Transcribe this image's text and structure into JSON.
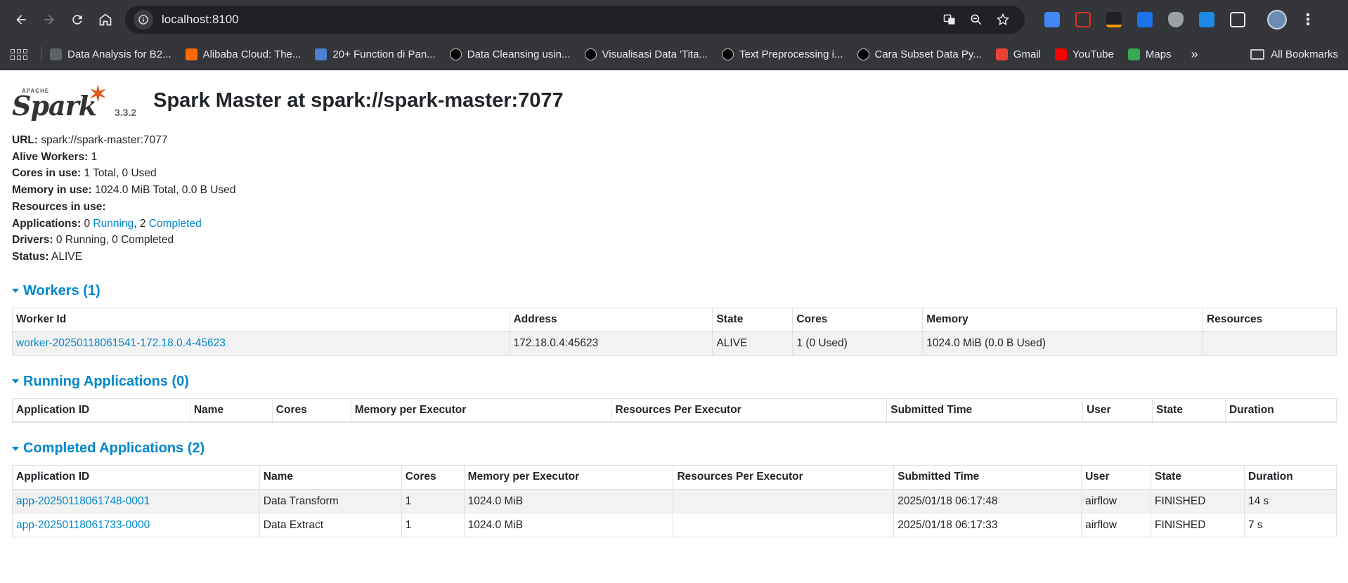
{
  "browser": {
    "url": "localhost:8100",
    "bookmarks": [
      {
        "label": "Data Analysis for B2...",
        "color": "#5f6368"
      },
      {
        "label": "Alibaba Cloud: The...",
        "color": "#ff6a00"
      },
      {
        "label": "20+ Function di Pan...",
        "color": "#4a7fd6"
      },
      {
        "label": "Data Cleansing usin...",
        "color": "#000000"
      },
      {
        "label": "Visualisasi Data 'Tita...",
        "color": "#000000"
      },
      {
        "label": "Text Preprocessing i...",
        "color": "#000000"
      },
      {
        "label": "Cara Subset Data Py...",
        "color": "#000000"
      },
      {
        "label": "Gmail",
        "color": "#ea4335"
      },
      {
        "label": "YouTube",
        "color": "#ff0000"
      },
      {
        "label": "Maps",
        "color": "#34a853"
      }
    ],
    "all_bookmarks": "All Bookmarks"
  },
  "spark": {
    "version": "3.3.2",
    "title": "Spark Master at spark://spark-master:7077",
    "summary": {
      "url_label": "URL:",
      "url": "spark://spark-master:7077",
      "alive_workers_label": "Alive Workers:",
      "alive_workers": "1",
      "cores_label": "Cores in use:",
      "cores": "1 Total, 0 Used",
      "memory_label": "Memory in use:",
      "memory": "1024.0 MiB Total, 0.0 B Used",
      "resources_label": "Resources in use:",
      "applications_label": "Applications:",
      "apps_running_count": "0",
      "apps_running_link": "Running",
      "apps_completed_count": "2",
      "apps_completed_link": "Completed",
      "drivers_label": "Drivers:",
      "drivers": "0 Running, 0 Completed",
      "status_label": "Status:",
      "status": "ALIVE"
    }
  },
  "workers": {
    "title": "Workers (1)",
    "columns": [
      "Worker Id",
      "Address",
      "State",
      "Cores",
      "Memory",
      "Resources"
    ],
    "rows": [
      {
        "id": "worker-20250118061541-172.18.0.4-45623",
        "address": "172.18.0.4:45623",
        "state": "ALIVE",
        "cores": "1 (0 Used)",
        "memory": "1024.0 MiB (0.0 B Used)",
        "resources": ""
      }
    ]
  },
  "running": {
    "title": "Running Applications (0)",
    "columns": [
      "Application ID",
      "Name",
      "Cores",
      "Memory per Executor",
      "Resources Per Executor",
      "Submitted Time",
      "User",
      "State",
      "Duration"
    ]
  },
  "completed": {
    "title": "Completed Applications (2)",
    "columns": [
      "Application ID",
      "Name",
      "Cores",
      "Memory per Executor",
      "Resources Per Executor",
      "Submitted Time",
      "User",
      "State",
      "Duration"
    ],
    "rows": [
      {
        "id": "app-20250118061748-0001",
        "name": "Data Transform",
        "cores": "1",
        "memory": "1024.0 MiB",
        "resources": "",
        "submitted": "2025/01/18 06:17:48",
        "user": "airflow",
        "state": "FINISHED",
        "duration": "14 s"
      },
      {
        "id": "app-20250118061733-0000",
        "name": "Data Extract",
        "cores": "1",
        "memory": "1024.0 MiB",
        "resources": "",
        "submitted": "2025/01/18 06:17:33",
        "user": "airflow",
        "state": "FINISHED",
        "duration": "7 s"
      }
    ]
  }
}
